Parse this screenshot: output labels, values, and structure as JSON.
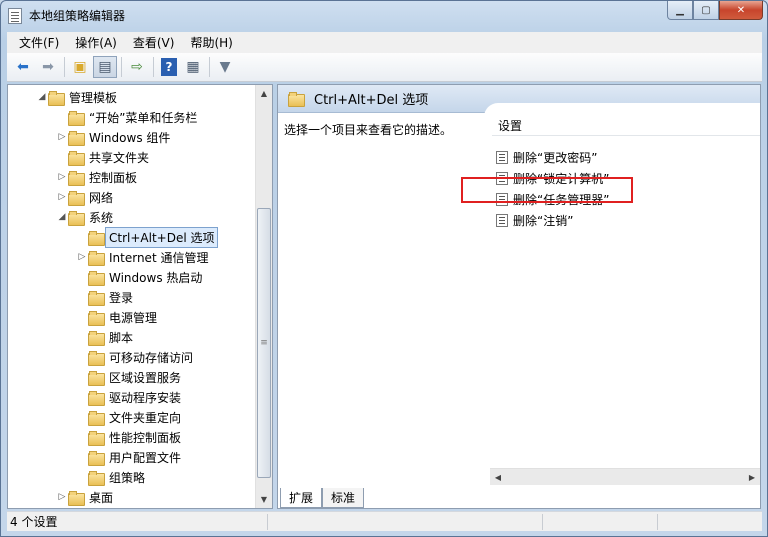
{
  "window": {
    "title": "本地组策略编辑器"
  },
  "menu": [
    "文件(F)",
    "操作(A)",
    "查看(V)",
    "帮助(H)"
  ],
  "toolbar": [
    "back-icon",
    "forward-icon",
    "up-folder-icon",
    "show-tree-icon",
    "export-icon",
    "help-icon",
    "properties-icon",
    "filter-icon"
  ],
  "tree": {
    "items": [
      {
        "label": "管理模板",
        "arrow": "◢"
      },
      {
        "label": "“开始”菜单和任务栏",
        "arrow": ""
      },
      {
        "label": "Windows 组件",
        "arrow": "▷"
      },
      {
        "label": "共享文件夹",
        "arrow": ""
      },
      {
        "label": "控制面板",
        "arrow": "▷"
      },
      {
        "label": "网络",
        "arrow": "▷"
      },
      {
        "label": "系统",
        "arrow": "◢"
      },
      {
        "label": "Ctrl+Alt+Del 选项",
        "arrow": ""
      },
      {
        "label": "Internet 通信管理",
        "arrow": "▷"
      },
      {
        "label": "Windows 热启动",
        "arrow": ""
      },
      {
        "label": "登录",
        "arrow": ""
      },
      {
        "label": "电源管理",
        "arrow": ""
      },
      {
        "label": "脚本",
        "arrow": ""
      },
      {
        "label": "可移动存储访问",
        "arrow": ""
      },
      {
        "label": "区域设置服务",
        "arrow": ""
      },
      {
        "label": "驱动程序安装",
        "arrow": ""
      },
      {
        "label": "文件夹重定向",
        "arrow": ""
      },
      {
        "label": "性能控制面板",
        "arrow": ""
      },
      {
        "label": "用户配置文件",
        "arrow": ""
      },
      {
        "label": "组策略",
        "arrow": ""
      },
      {
        "label": "桌面",
        "arrow": "▷"
      }
    ]
  },
  "right": {
    "header": "Ctrl+Alt+Del 选项",
    "description": "选择一个项目来查看它的描述。",
    "column": "设置",
    "settings": [
      "删除“更改密码”",
      "删除“锁定计算机”",
      "删除“任务管理器”",
      "删除“注销”"
    ]
  },
  "tabs": [
    "扩展",
    "标准"
  ],
  "status": "4 个设置",
  "colors": {
    "highlight": "#e02020",
    "selection": "#dcebfc"
  }
}
